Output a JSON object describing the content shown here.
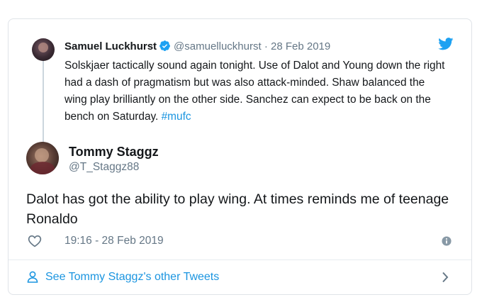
{
  "quoted_tweet": {
    "author_name": "Samuel Luckhurst",
    "handle": "@samuelluckhurst",
    "separator": "·",
    "date": "28 Feb 2019",
    "text": "Solskjaer tactically sound again tonight. Use of Dalot and Young down the right had a dash of pragmatism but was also attack-minded. Shaw balanced the wing play brilliantly on the other side. Sanchez can expect to be back on the bench on Saturday.",
    "hashtag": "#mufc",
    "verified_icon": "verified-badge-icon",
    "avatar": "avatar"
  },
  "tweet": {
    "author_name": "Tommy Staggz",
    "handle": "@T_Staggz88",
    "text": "Dalot has got the ability to play wing. At times reminds me of teenage Ronaldo",
    "timestamp": "19:16 - 28 Feb 2019",
    "like_icon": "heart-icon",
    "info_icon": "info-icon",
    "avatar": "avatar"
  },
  "footer": {
    "label": "See Tommy Staggz's other Tweets",
    "leading_icon": "person-icon",
    "trailing_icon": "chevron-right-icon"
  },
  "brand_icon": "twitter-bird-icon",
  "colors": {
    "link": "#1b95e0",
    "muted": "#657786",
    "text": "#14171a",
    "border": "#dfe3e8",
    "brand": "#1da1f2"
  }
}
